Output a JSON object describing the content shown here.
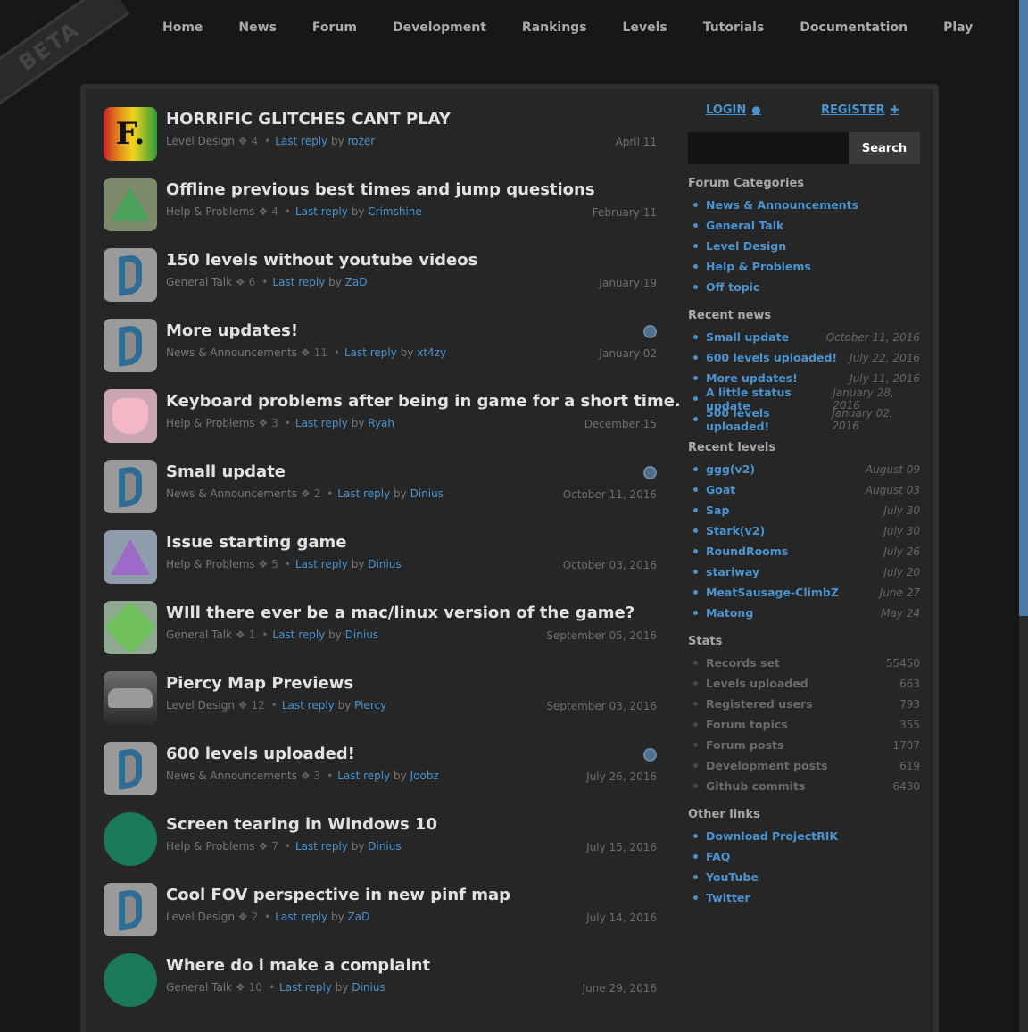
{
  "beta_label": "BETA",
  "nav": [
    "Home",
    "News",
    "Forum",
    "Development",
    "Rankings",
    "Levels",
    "Tutorials",
    "Documentation",
    "Play"
  ],
  "topics": [
    {
      "title": "HORRIFIC GLITCHES CANT PLAY",
      "category": "Level Design",
      "replies": "4",
      "last_reply_label": "Last reply",
      "by": "by",
      "user": "rozer",
      "date": "April 11",
      "avatar": "f-logo",
      "news": false
    },
    {
      "title": "Offline previous best times and jump questions",
      "category": "Help & Problems",
      "replies": "4",
      "last_reply_label": "Last reply",
      "by": "by",
      "user": "Crimshine",
      "date": "February 11",
      "avatar": "monster-green",
      "news": false
    },
    {
      "title": "150 levels without youtube videos",
      "category": "General Talk",
      "replies": "6",
      "last_reply_label": "Last reply",
      "by": "by",
      "user": "ZaD",
      "date": "January 19",
      "avatar": "d-logo",
      "news": false
    },
    {
      "title": "More updates!",
      "category": "News & Announcements",
      "replies": "11",
      "last_reply_label": "Last reply",
      "by": "by",
      "user": "xt4zy",
      "date": "January 02",
      "avatar": "d-logo",
      "news": true
    },
    {
      "title": "Keyboard problems after being in game for a short time.",
      "category": "Help & Problems",
      "replies": "3",
      "last_reply_label": "Last reply",
      "by": "by",
      "user": "Ryah",
      "date": "December 15",
      "avatar": "monster-pink",
      "news": false
    },
    {
      "title": "Small update",
      "category": "News & Announcements",
      "replies": "2",
      "last_reply_label": "Last reply",
      "by": "by",
      "user": "Dinius",
      "date": "October 11, 2016",
      "avatar": "d-logo",
      "news": true
    },
    {
      "title": "Issue starting game",
      "category": "Help & Problems",
      "replies": "5",
      "last_reply_label": "Last reply",
      "by": "by",
      "user": "Dinius",
      "date": "October 03, 2016",
      "avatar": "monster-purple",
      "news": false
    },
    {
      "title": "WIll there ever be a mac/linux version of the game?",
      "category": "General Talk",
      "replies": "1",
      "last_reply_label": "Last reply",
      "by": "by",
      "user": "Dinius",
      "date": "September 05, 2016",
      "avatar": "monster-star",
      "news": false
    },
    {
      "title": "Piercy Map Previews",
      "category": "Level Design",
      "replies": "12",
      "last_reply_label": "Last reply",
      "by": "by",
      "user": "Piercy",
      "date": "September 03, 2016",
      "avatar": "car",
      "news": false
    },
    {
      "title": "600 levels uploaded!",
      "category": "News & Announcements",
      "replies": "3",
      "last_reply_label": "Last reply",
      "by": "by",
      "user": "Joobz",
      "date": "July 26, 2016",
      "avatar": "d-logo",
      "news": true
    },
    {
      "title": "Screen tearing in Windows 10",
      "category": "Help & Problems",
      "replies": "7",
      "last_reply_label": "Last reply",
      "by": "by",
      "user": "Dinius",
      "date": "July 15, 2016",
      "avatar": "joobz",
      "news": false
    },
    {
      "title": "Cool FOV perspective in new pinf map",
      "category": "Level Design",
      "replies": "2",
      "last_reply_label": "Last reply",
      "by": "by",
      "user": "ZaD",
      "date": "July 14, 2016",
      "avatar": "d-logo",
      "news": false
    },
    {
      "title": "Where do i make a complaint",
      "category": "General Talk",
      "replies": "10",
      "last_reply_label": "Last reply",
      "by": "by",
      "user": "Dinius",
      "date": "June 29, 2016",
      "avatar": "joobz",
      "news": false
    }
  ],
  "sidebar": {
    "login": "LOGIN",
    "register": "REGISTER",
    "search_button": "Search",
    "search_placeholder": "",
    "forum_categories": {
      "title": "Forum Categories",
      "items": [
        "News & Announcements",
        "General Talk",
        "Level Design",
        "Help & Problems",
        "Off topic"
      ]
    },
    "recent_news": {
      "title": "Recent news",
      "items": [
        {
          "label": "Small update",
          "date": "October 11, 2016"
        },
        {
          "label": "600 levels uploaded!",
          "date": "July 22, 2016"
        },
        {
          "label": "More updates!",
          "date": "July 11, 2016"
        },
        {
          "label": "A little status update",
          "date": "January 28, 2016"
        },
        {
          "label": "500 levels uploaded!",
          "date": "January 02, 2016"
        }
      ]
    },
    "recent_levels": {
      "title": "Recent levels",
      "items": [
        {
          "label": "ggg(v2)",
          "date": "August 09"
        },
        {
          "label": "Goat",
          "date": "August 03"
        },
        {
          "label": "Sap",
          "date": "July 30"
        },
        {
          "label": "Stark(v2)",
          "date": "July 30"
        },
        {
          "label": "RoundRooms",
          "date": "July 26"
        },
        {
          "label": "stariway",
          "date": "July 20"
        },
        {
          "label": "MeatSausage-ClimbZ",
          "date": "June 27"
        },
        {
          "label": "Matong",
          "date": "May 24"
        }
      ]
    },
    "stats": {
      "title": "Stats",
      "items": [
        {
          "label": "Records set",
          "value": "55450"
        },
        {
          "label": "Levels uploaded",
          "value": "663"
        },
        {
          "label": "Registered users",
          "value": "793"
        },
        {
          "label": "Forum topics",
          "value": "355"
        },
        {
          "label": "Forum posts",
          "value": "1707"
        },
        {
          "label": "Development posts",
          "value": "619"
        },
        {
          "label": "Github commits",
          "value": "6430"
        }
      ]
    },
    "other_links": {
      "title": "Other links",
      "items": [
        "Download ProjectRIK",
        "FAQ",
        "YouTube",
        "Twitter"
      ]
    }
  }
}
